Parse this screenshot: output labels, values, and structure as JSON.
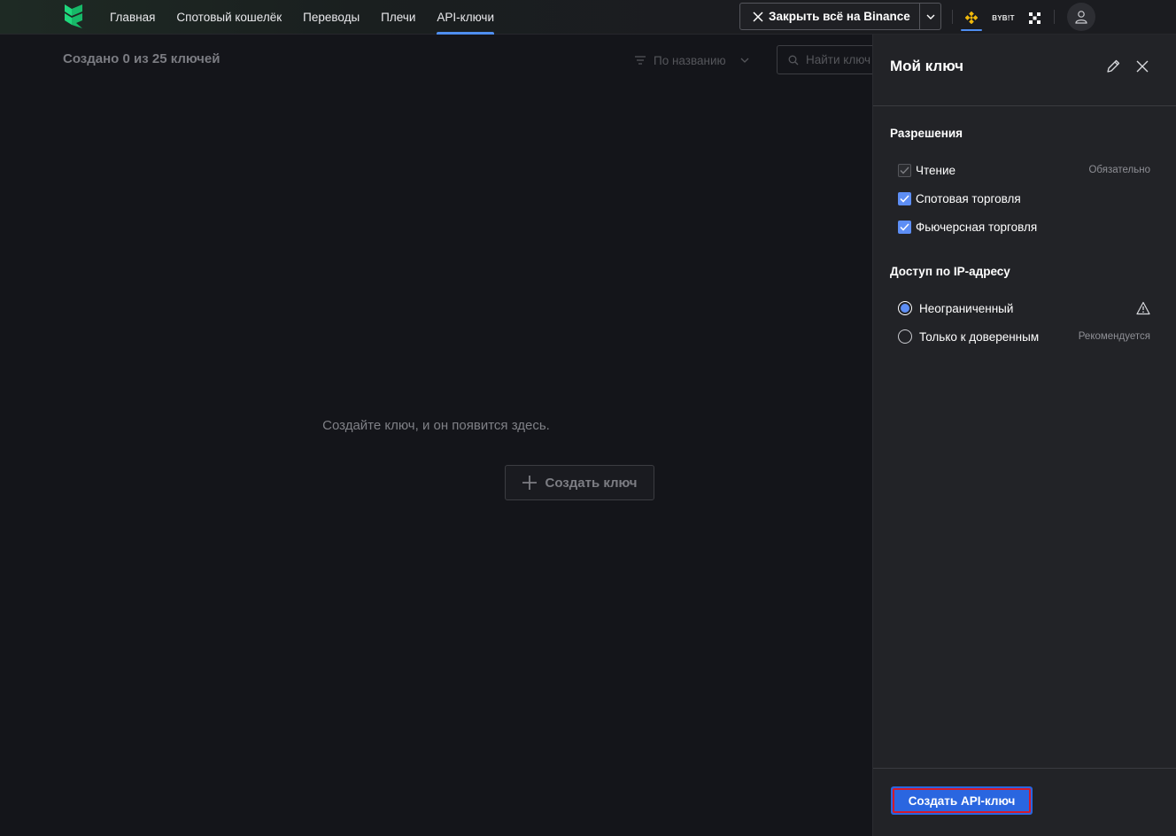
{
  "nav": {
    "items": [
      {
        "label": "Главная",
        "active": false
      },
      {
        "label": "Спотовый кошелёк",
        "active": false
      },
      {
        "label": "Переводы",
        "active": false
      },
      {
        "label": "Плечи",
        "active": false
      },
      {
        "label": "API-ключи",
        "active": true
      }
    ]
  },
  "header": {
    "close_all_label": "Закрыть всё на Binance",
    "exchanges": [
      {
        "name": "binance",
        "icon": "binance-logo-icon",
        "selected": true
      },
      {
        "name": "bybit",
        "label": "BYB!T",
        "icon": "bybit-logo-icon",
        "selected": false
      },
      {
        "name": "okx",
        "icon": "okx-logo-icon",
        "selected": false
      }
    ],
    "avatar_icon": "user-icon"
  },
  "main": {
    "count_title": "Создано 0 из 25 ключей",
    "sort_label": "По названию",
    "search_placeholder": "Найти ключ",
    "empty_message": "Создайте ключ, и он появится здесь.",
    "create_button": "Создать ключ"
  },
  "drawer": {
    "title": "Мой ключ",
    "permissions_title": "Разрешения",
    "permissions": [
      {
        "label": "Чтение",
        "checked": true,
        "disabled": true,
        "hint": "Обязательно"
      },
      {
        "label": "Спотовая торговля",
        "checked": true,
        "disabled": false,
        "hint": ""
      },
      {
        "label": "Фьючерсная торговля",
        "checked": true,
        "disabled": false,
        "hint": ""
      }
    ],
    "ip_title": "Доступ по IP-адресу",
    "ip_options": [
      {
        "label": "Неограниченный",
        "selected": true,
        "icon": "warning-icon",
        "hint": ""
      },
      {
        "label": "Только к доверенным",
        "selected": false,
        "hint": "Рекомендуется"
      }
    ],
    "submit_button": "Создать API-ключ"
  },
  "colors": {
    "accent": "#5d8ef5",
    "primary_button": "#2a66e0",
    "highlight_border": "#d51a2a",
    "logo_green": "#1fd77c",
    "binance_yellow": "#f0b90b"
  }
}
